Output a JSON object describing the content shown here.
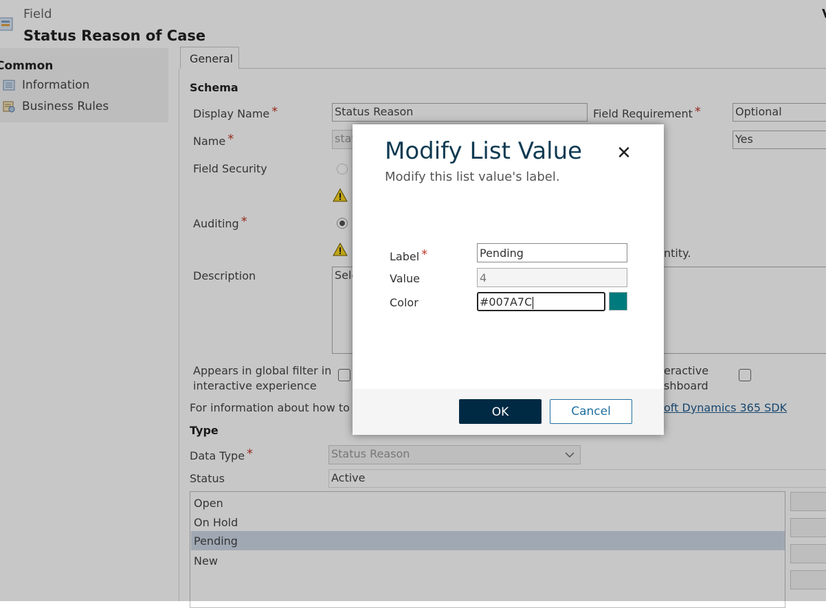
{
  "header": {
    "subtitle": "Field",
    "title": "Status Reason of Case",
    "corner_letter": "V"
  },
  "nav": {
    "section": "Common",
    "items": [
      {
        "label": "Information",
        "icon": "info-form-icon"
      },
      {
        "label": "Business Rules",
        "icon": "business-rules-icon"
      }
    ]
  },
  "tabs": [
    {
      "label": "General"
    }
  ],
  "schema": {
    "heading": "Schema",
    "display_name_label": "Display Name",
    "display_name_value": "Status Reason",
    "field_requirement_label": "Field Requirement",
    "field_requirement_value": "Optional",
    "searchable_value": "Yes",
    "name_label": "Name",
    "name_value_partial": "stat",
    "field_security_label": "Field Security",
    "auditing_label": "Auditing",
    "auditing_note_tail": "ntity.",
    "description_label": "Description",
    "description_value_partial": "Sele",
    "global_filter_label_line1": "Appears in global filter in",
    "global_filter_label_line2": "interactive experience",
    "dashboard_label_line1": "eractive",
    "dashboard_label_line2": "shboard",
    "info_text_partial": "For information about how to int",
    "sdk_link_partial": "oft Dynamics 365 SDK"
  },
  "type": {
    "heading": "Type",
    "data_type_label": "Data Type",
    "data_type_value": "Status Reason",
    "status_label": "Status",
    "status_value": "Active",
    "options": [
      "Open",
      "On Hold",
      "Pending",
      "New"
    ],
    "selected_index": 2
  },
  "modal": {
    "title": "Modify List Value",
    "subtitle": "Modify this list value's label.",
    "close_glyph": "✕",
    "label_label": "Label",
    "label_value": "Pending",
    "value_label": "Value",
    "value_value": "4",
    "color_label": "Color",
    "color_value": "#007A7C",
    "ok_label": "OK",
    "cancel_label": "Cancel"
  },
  "colors": {
    "swatch": "#007A7C",
    "ok_button": "#002a44",
    "accent_link": "#1f6f9f"
  }
}
